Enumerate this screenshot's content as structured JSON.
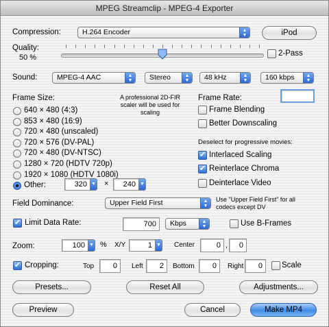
{
  "window": {
    "title": "MPEG Streamclip - MPEG-4 Exporter"
  },
  "compression": {
    "label": "Compression:",
    "value": "H.264 Encoder",
    "ipod_button": "iPod"
  },
  "quality": {
    "label": "Quality:",
    "percent_text": "50 %",
    "level": 0.5,
    "two_pass_label": "2-Pass",
    "two_pass_checked": false
  },
  "sound": {
    "label": "Sound:",
    "codec": "MPEG-4 AAC",
    "channels": "Stereo",
    "rate": "48 kHz",
    "bitrate": "160 kbps"
  },
  "frame_size": {
    "label": "Frame Size:",
    "note": "A professional 2D-FIR scaler will be used for scaling",
    "options": [
      {
        "label": "640 × 480  (4:3)",
        "selected": false
      },
      {
        "label": "853 × 480  (16:9)",
        "selected": false
      },
      {
        "label": "720 × 480  (unscaled)",
        "selected": false
      },
      {
        "label": "720 × 576  (DV-PAL)",
        "selected": false
      },
      {
        "label": "720 × 480  (DV-NTSC)",
        "selected": false
      },
      {
        "label": "1280 × 720  (HDTV 720p)",
        "selected": false
      },
      {
        "label": "1920 × 1080  (HDTV 1080i)",
        "selected": false
      },
      {
        "label": "Other:",
        "selected": true
      }
    ],
    "other_width": "320",
    "times": "×",
    "other_height": "240"
  },
  "frame_rate": {
    "label": "Frame Rate:",
    "value": "",
    "frame_blending": "Frame Blending",
    "better_downscaling": "Better Downscaling",
    "deselect_note": "Deselect for progressive movies:",
    "interlaced_scaling": "Interlaced Scaling",
    "reinterlace_chroma": "Reinterlace Chroma",
    "deinterlace_video": "Deinterlace Video"
  },
  "field_dominance": {
    "label": "Field Dominance:",
    "value": "Upper Field First",
    "note": "Use \"Upper Field First\" for all codecs except DV"
  },
  "data_rate": {
    "label": "Limit Data Rate:",
    "value": "700",
    "unit": "Kbps",
    "use_bframes": "Use B-Frames"
  },
  "zoom": {
    "label": "Zoom:",
    "value": "100",
    "percent": "%",
    "xy_label": "X/Y",
    "xy_value": "1",
    "center_label": "Center",
    "center_x": "0",
    "comma": ",",
    "center_y": "0"
  },
  "cropping": {
    "label": "Cropping:",
    "top_label": "Top",
    "top": "0",
    "left_label": "Left",
    "left": "2",
    "bottom_label": "Bottom",
    "bottom": "0",
    "right_label": "Right",
    "right": "0",
    "scale_label": "Scale"
  },
  "buttons": {
    "presets": "Presets...",
    "reset_all": "Reset All",
    "adjustments": "Adjustments...",
    "preview": "Preview",
    "cancel": "Cancel",
    "make": "Make MP4"
  }
}
